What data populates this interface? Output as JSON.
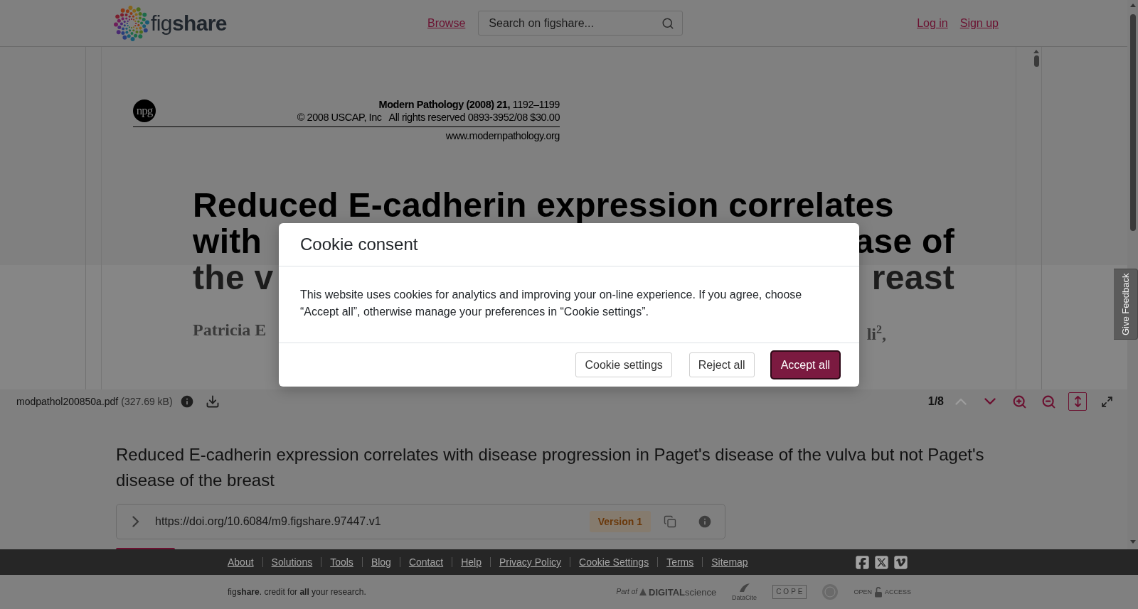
{
  "header": {
    "logo": "fig**share**",
    "nav_links": [
      {
        "label": "Browse"
      }
    ],
    "search": {
      "placeholder": "Search on figshare..."
    },
    "account_links": [
      {
        "label": "Log in"
      },
      {
        "label": "Sign up"
      }
    ]
  },
  "viewer": {
    "page": {
      "publisher_mark": "npg",
      "journal_line": "**Modern Pathology (2008) 21,** 1192–1199",
      "copyright": "© 2008 USCAP, Inc",
      "rights": "All rights reserved 0893-3952/08 $30.00",
      "website": "www.modernpathology.org",
      "title_lines": [
        {
          "left": "Reduced E-cadherin expression correlates",
          "faded": false
        },
        {
          "left": "with",
          "right": "ase of",
          "faded": false
        },
        {
          "left": "the v",
          "right": "reast",
          "faded": true
        }
      ],
      "author_lines": [
        {
          "left": "Patricia E",
          "right": "li$^{2}$,",
          "faded": true
        }
      ]
    },
    "toolbar": {
      "file_name": "modpathol200850a.pdf",
      "file_size": "(327.69 kB)",
      "page_indicator": "1/8",
      "page_controls": [
        {
          "kind": "previous-page",
          "disabled": true,
          "active": false
        },
        {
          "kind": "next-page",
          "disabled": false,
          "active": false
        },
        {
          "kind": "zoom-in",
          "disabled": false,
          "active": false
        },
        {
          "kind": "zoom-out",
          "disabled": false,
          "active": false
        },
        {
          "kind": "fit-height",
          "disabled": false,
          "active": true
        },
        {
          "kind": "fullscreen",
          "disabled": false,
          "active": false
        }
      ]
    }
  },
  "item": {
    "title": "Reduced E-cadherin expression correlates with disease progression in Paget's disease of the vulva but not Paget's disease of the breast",
    "doi": {
      "url": "https://doi.org/10.6084/m9.figshare.97447.v1",
      "expanded": false,
      "version": "Version 1"
    }
  },
  "footer": {
    "links": [
      {
        "label": "About"
      },
      {
        "label": "Solutions"
      },
      {
        "label": "Tools"
      },
      {
        "label": "Blog"
      },
      {
        "label": "Contact"
      },
      {
        "label": "Help"
      },
      {
        "label": "Privacy Policy"
      },
      {
        "label": "Cookie Settings"
      },
      {
        "label": "Terms"
      },
      {
        "label": "Sitemap"
      }
    ],
    "social": [
      {
        "kind": "facebook"
      },
      {
        "kind": "x"
      },
      {
        "kind": "vimeo"
      }
    ],
    "tagline": "fig**share**. credit for **all** your research.",
    "partners": [
      {
        "kind": "digital-science",
        "prefix": "Part of",
        "name": "**DIGITAL**science"
      },
      {
        "kind": "datacite",
        "name": "DataCite"
      },
      {
        "kind": "cope",
        "name": "COPE"
      },
      {
        "kind": "seal"
      },
      {
        "kind": "open-access",
        "prefix": "OPEN",
        "name": "ACCESS"
      }
    ]
  },
  "cookie_dialog": {
    "title": "Cookie consent",
    "message": "This website uses cookies for analytics and improving your on-line experience. If you agree, choose “Accept all”, otherwise manage your preferences in “Cookie settings”.",
    "buttons": [
      {
        "label": "Cookie settings",
        "kind": "secondary",
        "focused": false
      },
      {
        "label": "Reject all",
        "kind": "secondary",
        "focused": false
      },
      {
        "label": "Accept all",
        "kind": "primary",
        "focused": true
      }
    ]
  },
  "feedback_tab": {
    "label": "Give Feedback"
  }
}
